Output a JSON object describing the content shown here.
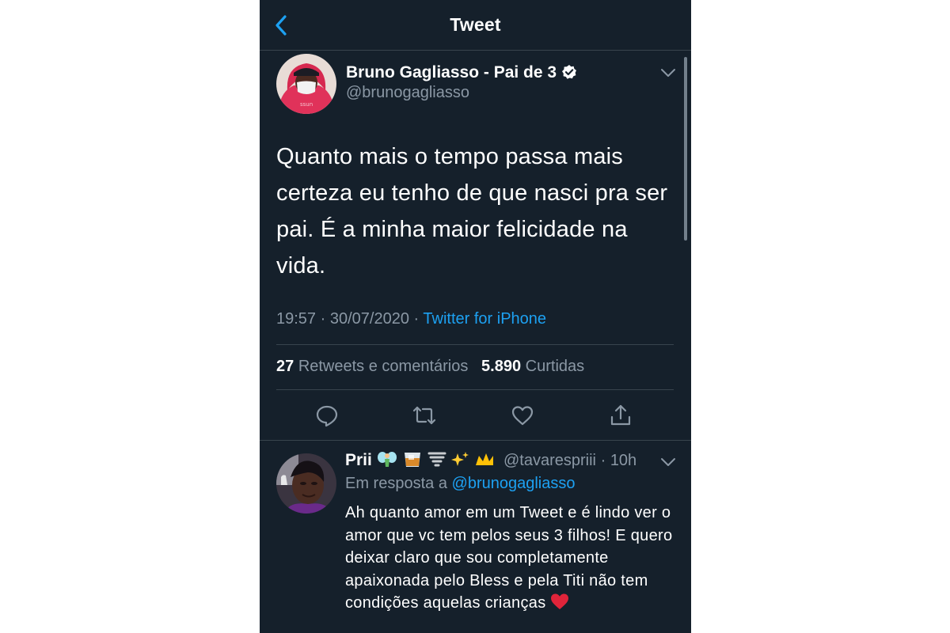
{
  "navbar": {
    "title": "Tweet"
  },
  "tweet": {
    "author_name": "Bruno Gagliasso - Pai de 3",
    "author_handle": "@brunogagliasso",
    "text": "Quanto mais o tempo passa mais certeza eu tenho de que nasci pra ser pai. É a minha maior felicidade na vida.",
    "time": "19:57",
    "date": "30/07/2020",
    "separator": "·",
    "source": "Twitter for iPhone",
    "retweets_count": "27",
    "retweets_label": "Retweets e comentários",
    "likes_count": "5.890",
    "likes_label": "Curtidas"
  },
  "actions": [
    "reply-icon",
    "retweet-icon",
    "like-icon",
    "share-icon"
  ],
  "reply": {
    "name": "Prii",
    "emojis": [
      "fairy-emoji",
      "whiskey-glass-emoji",
      "tornado-emoji",
      "sparkles-emoji",
      "crown-emoji"
    ],
    "handle": "@tavarespriii",
    "time": "10h",
    "separator": "·",
    "in_reply_to_label": "Em resposta a",
    "in_reply_to_handle": "@brunogagliasso",
    "text": "Ah quanto amor em um Tweet e é lindo ver o amor que vc tem pelos seus 3 filhos! E quero deixar claro que sou completamente apaixonada pelo Bless e pela Titi não tem condições aquelas crianças",
    "trailing_emoji": "red-heart-emoji"
  },
  "colors": {
    "background": "#15202b",
    "accent": "#1da1f2",
    "secondary_text": "#8b98a5",
    "border": "#38444d"
  }
}
